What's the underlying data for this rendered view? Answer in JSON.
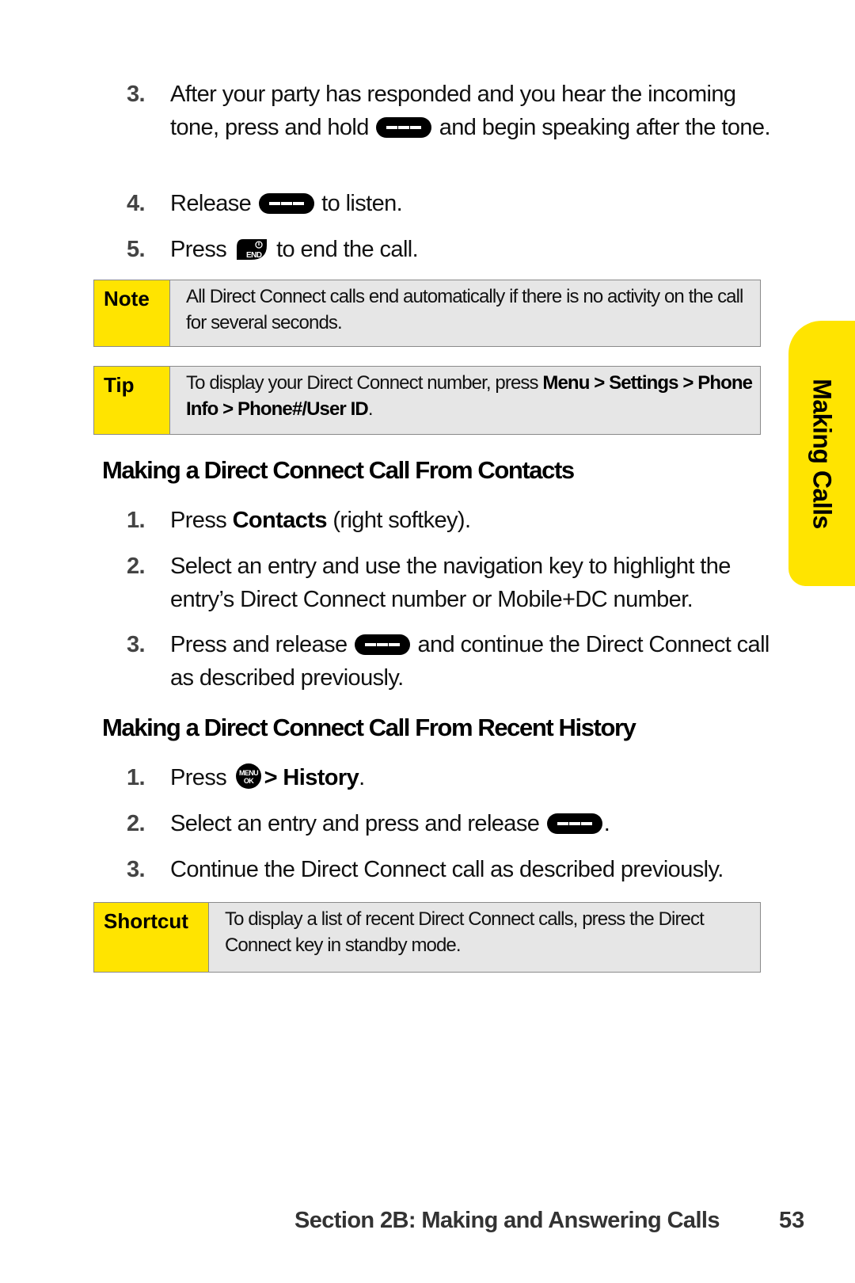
{
  "intro_steps": [
    {
      "num": "3.",
      "before": "After your party has responded and you hear the incoming tone, press and hold",
      "key": "direct-connect-key",
      "after": "and begin speaking after the tone."
    },
    {
      "num": "4.",
      "before": "Release",
      "key": "direct-connect-key",
      "after": "to listen."
    },
    {
      "num": "5.",
      "before": "Press",
      "key": "end-key",
      "after": "to end the call."
    }
  ],
  "note": {
    "label": "Note",
    "text": "All Direct Connect calls end automatically if there is no activity on the call for several seconds."
  },
  "tip": {
    "label": "Tip",
    "text_before": "To display your Direct Connect number, press ",
    "path_1": "Menu > Settings >",
    "path_2": "Phone Info > Phone#/User ID",
    "text_after": "."
  },
  "section_contacts": {
    "heading": "Making a Direct Connect Call From Contacts",
    "steps": [
      {
        "num": "1.",
        "before": "Press ",
        "bold": "Contacts",
        "after": " (right softkey)."
      },
      {
        "num": "2.",
        "text": "Select an entry and use the navigation key to highlight the entry’s Direct Connect number or Mobile+DC number."
      },
      {
        "num": "3.",
        "before": "Press and release",
        "key": "direct-connect-key",
        "after": "and continue the Direct Connect call as described previously."
      }
    ]
  },
  "section_history": {
    "heading": "Making a Direct Connect Call From Recent History",
    "steps": [
      {
        "num": "1.",
        "before": "Press",
        "key": "menu-ok-key",
        "bold": "> History",
        "after": "."
      },
      {
        "num": "2.",
        "before": "Select an entry and press and release",
        "key": "direct-connect-key",
        "after": "."
      },
      {
        "num": "3.",
        "text": "Continue the Direct Connect call as described previously."
      }
    ]
  },
  "shortcut": {
    "label": "Shortcut",
    "text": "To display a list of recent Direct Connect calls, press the Direct Connect key in standby mode."
  },
  "side_tab": {
    "label": "Making Calls",
    "color": "#ffe400"
  },
  "footer": {
    "section": "Section 2B: Making and Answering Calls",
    "page": "53"
  },
  "key_glyphs": {
    "end_key_label": "END",
    "menu_key_top": "MENU",
    "menu_key_bottom": "OK"
  }
}
